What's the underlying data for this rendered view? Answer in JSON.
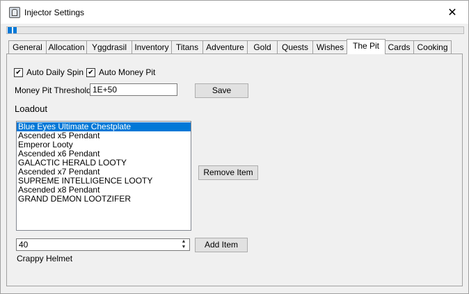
{
  "window": {
    "title": "Injector Settings",
    "close_glyph": "✕",
    "progress": 0.02
  },
  "tabs": [
    {
      "label": "General"
    },
    {
      "label": "Allocation"
    },
    {
      "label": "Yggdrasil"
    },
    {
      "label": "Inventory"
    },
    {
      "label": "Titans"
    },
    {
      "label": "Adventure"
    },
    {
      "label": "Gold"
    },
    {
      "label": "Quests"
    },
    {
      "label": "Wishes"
    },
    {
      "label": "The Pit",
      "active": true
    },
    {
      "label": "Cards"
    },
    {
      "label": "Cooking"
    }
  ],
  "pit": {
    "auto_daily_spin": {
      "label": "Auto Daily Spin",
      "checked": true
    },
    "auto_money_pit": {
      "label": "Auto Money Pit",
      "checked": true
    },
    "threshold_label": "Money Pit Threshold",
    "threshold_value": "1E+50",
    "save_label": "Save",
    "loadout_label": "Loadout",
    "loadout_items": [
      "Blue Eyes Ultimate Chestplate",
      "Ascended x5 Pendant",
      "Emperor Looty",
      "Ascended x6 Pendant",
      "GALACTIC HERALD LOOTY",
      "Ascended x7 Pendant",
      "SUPREME INTELLIGENCE LOOTY",
      "Ascended x8 Pendant",
      "GRAND DEMON LOOTZIFER"
    ],
    "selected_index": 0,
    "remove_label": "Remove Item",
    "item_id_value": "40",
    "add_label": "Add Item",
    "item_name": "Crappy Helmet"
  },
  "icons": {
    "app": "injector-app-icon",
    "close": "close-icon",
    "check": "checkmark-icon",
    "spin_up": "chevron-up-icon",
    "spin_down": "chevron-down-icon"
  },
  "colors": {
    "selection": "#0078d7",
    "window_bg": "#f0f0f0"
  }
}
